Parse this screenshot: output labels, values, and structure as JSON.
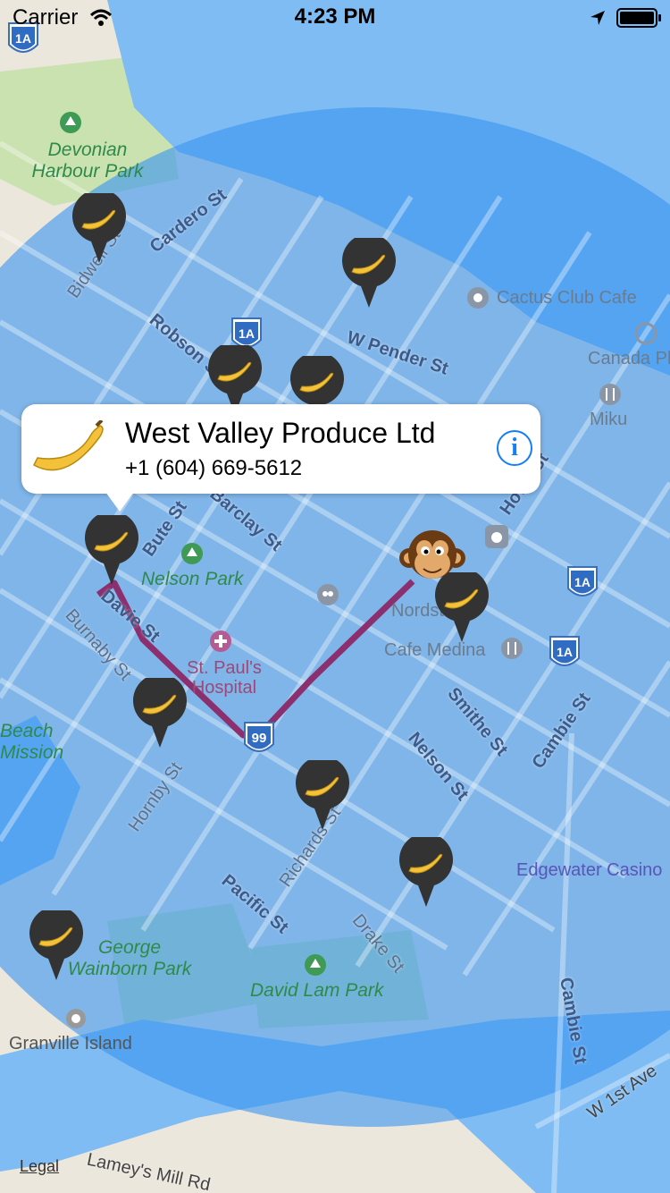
{
  "status_bar": {
    "carrier": "Carrier",
    "time": "4:23 PM"
  },
  "map": {
    "streets": [
      "Cardero St",
      "Robson St",
      "W Pender St",
      "Bute St",
      "Barclay St",
      "Davie St",
      "Burnaby St",
      "Hornby St",
      "Howe St",
      "Smithe St",
      "Nelson St",
      "Cambie St",
      "Richards St",
      "Pacific St",
      "Drake St",
      "W 1st Ave",
      "Lamey's Mill Rd",
      "Bidwell St"
    ],
    "parks": [
      "Devonian Harbour Park",
      "Nelson Park",
      "George Wainborn Park",
      "David Lam Park",
      "Beach Mission"
    ],
    "pois": [
      "Cactus Club Cafe",
      "Canada Place",
      "Miku",
      "Cafe Medina",
      "Nordstrom",
      "Granville Island",
      "St. Paul's Hospital",
      "Edgewater Casino"
    ],
    "highway_shields": [
      "1A",
      "99"
    ],
    "accent_colors": {
      "coverage": "#3c96f0",
      "route": "#8c2f6e",
      "callout_info": "#1580f5",
      "pin": "#333333",
      "banana": "#f3c23a"
    }
  },
  "callout": {
    "title": "West Valley Produce Ltd",
    "phone": "+1 (604) 669-5612",
    "info_icon": "i"
  },
  "legal": "Legal"
}
